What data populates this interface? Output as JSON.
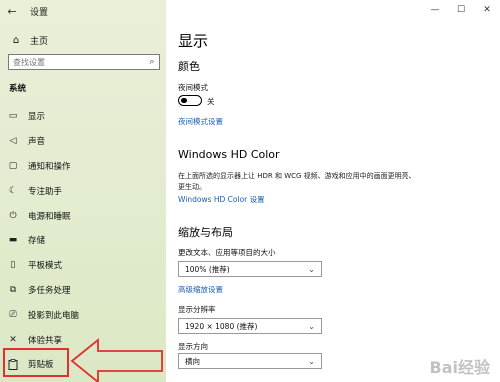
{
  "window": {
    "title": "设置",
    "back_glyph": "←",
    "controls": [
      "—",
      "☐",
      "✕"
    ]
  },
  "sidebar": {
    "home_label": "主页",
    "search_placeholder": "查找设置",
    "section_label": "系统",
    "items": [
      {
        "icon": "monitor-icon",
        "glyph": "▭",
        "label": "显示"
      },
      {
        "icon": "speaker-icon",
        "glyph": "◁",
        "label": "声音"
      },
      {
        "icon": "notification-icon",
        "glyph": "▢",
        "label": "通知和操作"
      },
      {
        "icon": "moon-icon",
        "glyph": "☾",
        "label": "专注助手"
      },
      {
        "icon": "power-icon",
        "glyph": "⏻",
        "label": "电源和睡眠"
      },
      {
        "icon": "storage-icon",
        "glyph": "▬",
        "label": "存储"
      },
      {
        "icon": "tablet-icon",
        "glyph": "▯",
        "label": "平板模式"
      },
      {
        "icon": "multitask-icon",
        "glyph": "⧉",
        "label": "多任务处理"
      },
      {
        "icon": "project-icon",
        "glyph": "⎚",
        "label": "投影到此电脑"
      },
      {
        "icon": "share-icon",
        "glyph": "✕",
        "label": "体验共享"
      },
      {
        "icon": "clipboard-icon",
        "glyph": "📋",
        "label": "剪贴板"
      }
    ]
  },
  "main": {
    "title": "显示",
    "color_heading": "颜色",
    "night_mode_label": "夜间模式",
    "night_mode_state": "关",
    "night_mode_link": "夜间模式设置",
    "hdr_heading": "Windows HD Color",
    "hdr_desc": "在上面所选的显示器上让 HDR 和 WCG 视频、游戏和应用中的画面更明亮、更生动。",
    "hdr_link": "Windows HD Color 设置",
    "scale_heading": "缩放与布局",
    "scale_label": "更改文本、应用等项目的大小",
    "scale_value": "100% (推荐)",
    "scale_link": "高级缩放设置",
    "resolution_label": "显示分辨率",
    "resolution_value": "1920 × 1080 (推荐)",
    "orientation_label": "显示方向",
    "orientation_value": "横向"
  },
  "watermark": "Bai经验",
  "colors": {
    "accent": "#2d6bc4",
    "link": "#1a5fb4",
    "annotation": "#e03030"
  }
}
